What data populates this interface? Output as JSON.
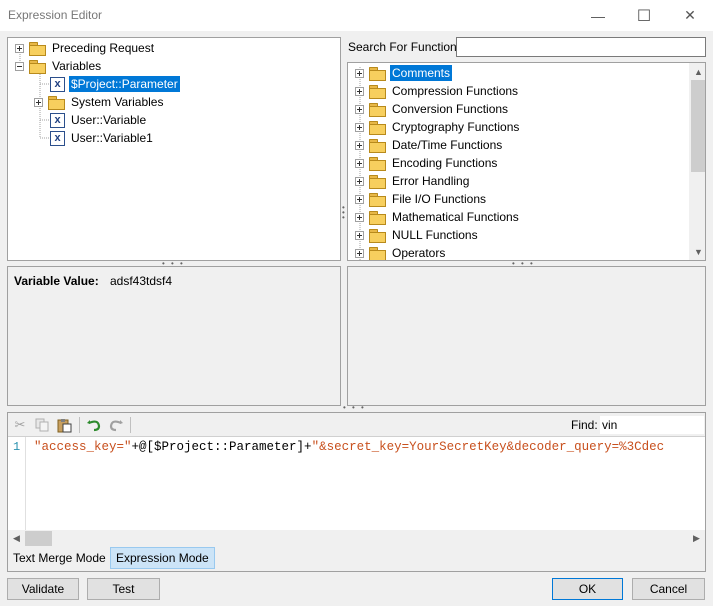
{
  "window": {
    "title": "Expression Editor",
    "minimize_glyph": "—",
    "maximize_glyph": "☐",
    "close_glyph": "✕"
  },
  "variables_tree": {
    "items": [
      {
        "label": "Preceding Request",
        "type": "folder",
        "expander": "plus"
      },
      {
        "label": "Variables",
        "type": "folder",
        "expander": "minus"
      },
      {
        "label": "$Project::Parameter",
        "type": "variable",
        "selected": true
      },
      {
        "label": "System Variables",
        "type": "folder",
        "expander": "plus"
      },
      {
        "label": "User::Variable",
        "type": "variable"
      },
      {
        "label": "User::Variable1",
        "type": "variable"
      }
    ]
  },
  "function_search": {
    "label": "Search For Function:",
    "value": ""
  },
  "functions_tree": {
    "items": [
      {
        "label": "Comments",
        "selected": true
      },
      {
        "label": "Compression Functions"
      },
      {
        "label": "Conversion Functions"
      },
      {
        "label": "Cryptography Functions"
      },
      {
        "label": "Date/Time Functions"
      },
      {
        "label": "Encoding Functions"
      },
      {
        "label": "Error Handling"
      },
      {
        "label": "File I/O Functions"
      },
      {
        "label": "Mathematical Functions"
      },
      {
        "label": "NULL Functions"
      },
      {
        "label": "Operators"
      }
    ]
  },
  "variable_value": {
    "label": "Variable Value:",
    "value": "adsf43tdsf4"
  },
  "editor": {
    "find_label": "Find:",
    "find_value": "vin",
    "line_number": "1",
    "code": {
      "part1": "\"access_key=\"",
      "part2": "+@[$Project::Parameter]+",
      "part3": "\"&secret_key=YourSecretKey&decoder_query=%3Cdec"
    }
  },
  "modes": {
    "text_merge": "Text Merge Mode",
    "expression": "Expression Mode"
  },
  "buttons": {
    "validate": "Validate",
    "test": "Test",
    "ok": "OK",
    "cancel": "Cancel"
  },
  "colors": {
    "selection": "#0078d7",
    "string_literal": "#c8501e",
    "active_mode_bg": "#cce4f7"
  },
  "icons": {
    "cut": "scissors-icon",
    "copy": "copy-icon",
    "paste": "paste-icon",
    "undo": "undo-icon",
    "redo": "redo-icon"
  }
}
